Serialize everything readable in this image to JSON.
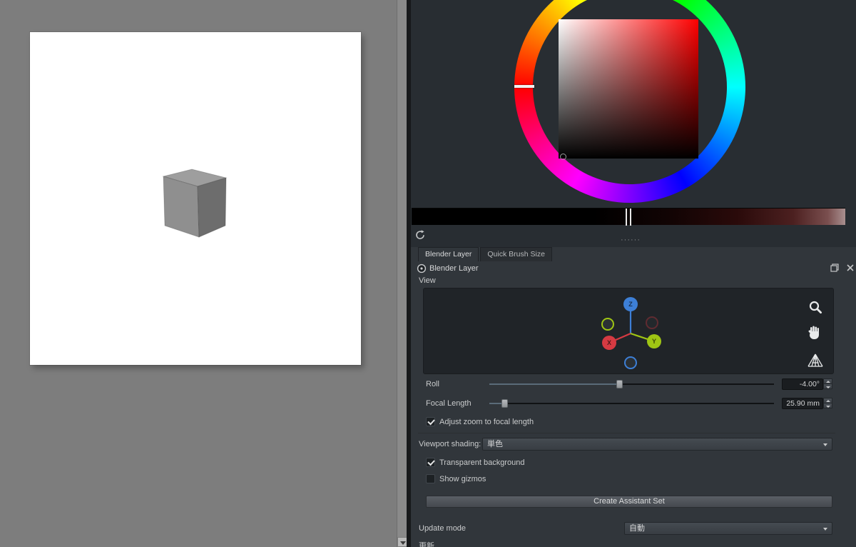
{
  "tabs": [
    {
      "label": "Blender Layer",
      "active": true
    },
    {
      "label": "Quick Brush Size",
      "active": false
    }
  ],
  "docker": {
    "title": "Blender Layer",
    "view_label": "View",
    "axes": {
      "x": "X",
      "y": "Y",
      "z": "Z"
    },
    "roll": {
      "label": "Roll",
      "value": "-4.00°"
    },
    "focal": {
      "label": "Focal Length",
      "value": "25.90 mm"
    },
    "adjust_zoom": {
      "label": "Adjust zoom to focal length",
      "checked": true
    },
    "viewport_shading": {
      "label": "Viewport shading:",
      "value": "単色"
    },
    "transparent_bg": {
      "label": "Transparent background",
      "checked": true
    },
    "show_gizmos": {
      "label": "Show gizmos",
      "checked": false
    },
    "create_button": "Create Assistant Set",
    "update_mode": {
      "label": "Update mode",
      "value": "自動"
    },
    "partial_bottom_label": "更新"
  },
  "icons": {
    "refresh-icon": "circular arrow ⟳",
    "magnifier-icon": "zoom lens",
    "pan-hand-icon": "hand",
    "grid-icon": "perspective mesh",
    "float-icon": "overlapping squares",
    "close-icon": "✕",
    "combo-arrow": "▾",
    "spin-up": "▲",
    "spin-down": "▼",
    "scroll-down": "▼"
  },
  "colors": {
    "panel_bg": "#31363b",
    "picker_area_bg": "#282d32",
    "canvas_area_bg": "#7d7d7d",
    "axis_x": "#d63a42",
    "axis_y": "#9fc514",
    "axis_z": "#3d7fd6"
  }
}
